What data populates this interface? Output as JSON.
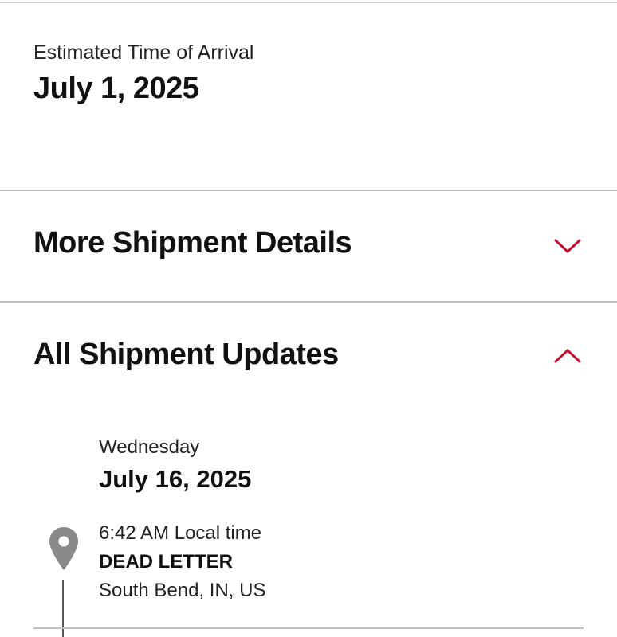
{
  "eta": {
    "label": "Estimated Time of Arrival",
    "date": "July 1, 2025"
  },
  "sections": [
    {
      "title": "More Shipment Details",
      "state": "collapsed",
      "icon": "chevron-down-icon"
    },
    {
      "title": "All Shipment Updates",
      "state": "expanded",
      "icon": "chevron-up-icon"
    }
  ],
  "updates": {
    "day": "Wednesday",
    "date": "July 16, 2025",
    "events": [
      {
        "time": "6:42 AM Local time",
        "status": "DEAD LETTER",
        "location": "South Bend, IN, US",
        "icon": "location-pin-icon"
      }
    ]
  },
  "colors": {
    "accent": "#c8102e",
    "pin": "#8a8a8a",
    "divider": "#bdbdbd"
  }
}
